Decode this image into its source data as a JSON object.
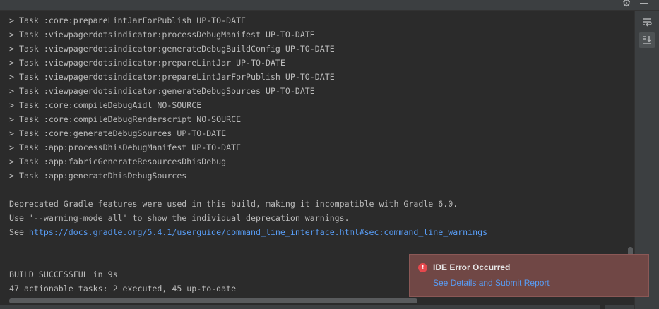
{
  "window": {
    "toolbar_icons": [
      "gear-icon",
      "minimize-icon"
    ]
  },
  "console": {
    "lines": [
      "> Task :core:prepareLintJarForPublish UP-TO-DATE",
      "> Task :viewpagerdotsindicator:processDebugManifest UP-TO-DATE",
      "> Task :viewpagerdotsindicator:generateDebugBuildConfig UP-TO-DATE",
      "> Task :viewpagerdotsindicator:prepareLintJar UP-TO-DATE",
      "> Task :viewpagerdotsindicator:prepareLintJarForPublish UP-TO-DATE",
      "> Task :viewpagerdotsindicator:generateDebugSources UP-TO-DATE",
      "> Task :core:compileDebugAidl NO-SOURCE",
      "> Task :core:compileDebugRenderscript NO-SOURCE",
      "> Task :core:generateDebugSources UP-TO-DATE",
      "> Task :app:processDhisDebugManifest UP-TO-DATE",
      "> Task :app:fabricGenerateResourcesDhisDebug",
      "> Task :app:generateDhisDebugSources",
      "",
      "Deprecated Gradle features were used in this build, making it incompatible with Gradle 6.0.",
      "Use '--warning-mode all' to show the individual deprecation warnings.",
      "",
      "",
      "BUILD SUCCESSFUL in 9s",
      "47 actionable tasks: 2 executed, 45 up-to-date"
    ],
    "see_prefix": "See ",
    "see_link": "https://docs.gradle.org/5.4.1/userguide/command_line_interface.html#sec:command_line_warnings"
  },
  "right_toolbar": {
    "buttons": [
      "soft-wrap-icon",
      "scroll-to-end-icon"
    ]
  },
  "notification": {
    "title": "IDE Error Occurred",
    "link": "See Details and Submit Report",
    "icon": "error-icon",
    "background": "#704745",
    "accent": "#e5484d"
  },
  "colors": {
    "console_bg": "#2b2b2b",
    "console_text": "#bbbbbb",
    "link": "#589df6",
    "panel_bg": "#3c3f41"
  }
}
